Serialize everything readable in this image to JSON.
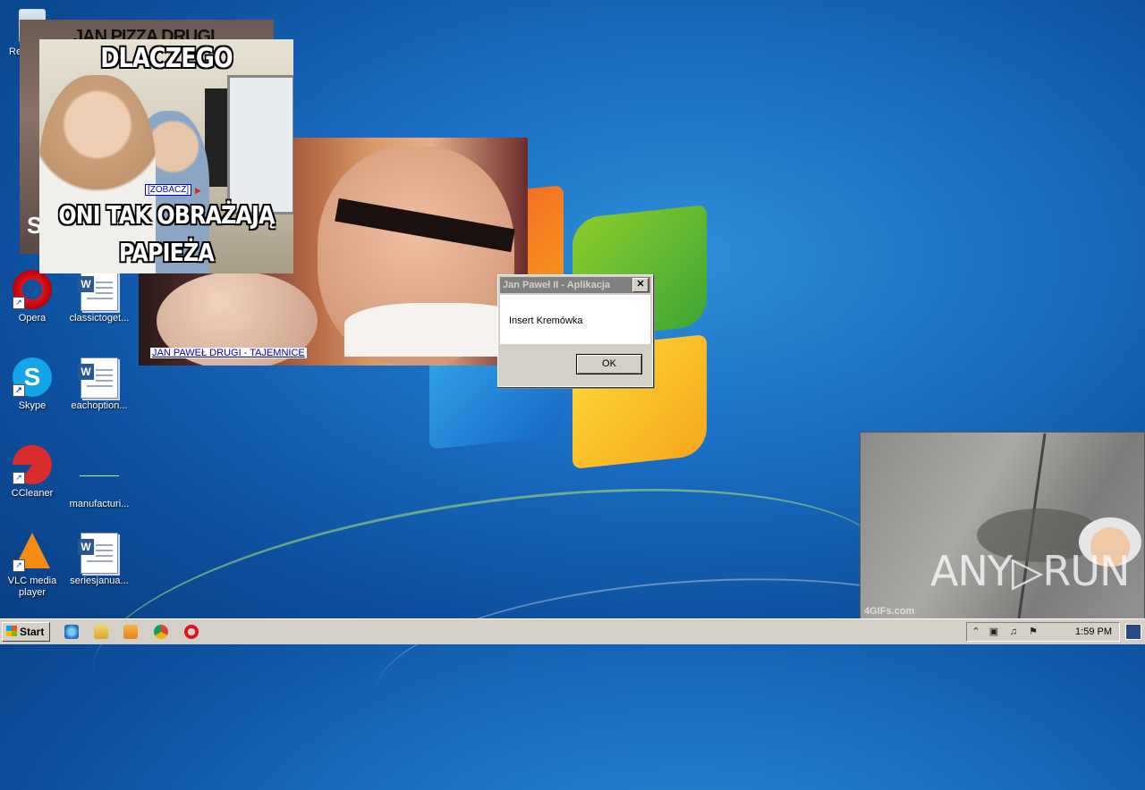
{
  "desktop": {
    "icons": [
      {
        "label": "Opera"
      },
      {
        "label": "classictoget..."
      },
      {
        "label": "Skype"
      },
      {
        "label": "eachoption..."
      },
      {
        "label": "CCleaner"
      },
      {
        "label": "manufacturi..."
      },
      {
        "label": "VLC media player"
      },
      {
        "label": "seriesjanua..."
      }
    ],
    "partial_label": "Re"
  },
  "popups": {
    "video": {
      "caption": "JAN PAWEŁ DRUGI - TAJEMNICE"
    },
    "meme_back": {
      "top_text": "JAN PIZZA DRUGI",
      "side_text": "S"
    },
    "meme": {
      "top_text": "DLACZEGO",
      "bottom_line1": "ONI TAK OBRAŻAJĄ",
      "bottom_line2": "PAPIEŻA",
      "link": "[ZOBACZ]"
    },
    "gif": {
      "watermark_small": "4GIFs.com"
    }
  },
  "messagebox": {
    "title": "Jan Paweł II - Aplikacja",
    "message": "Insert Kremówka",
    "ok_label": "OK",
    "close_label": "✕"
  },
  "watermark": "ANY▷RUN",
  "taskbar": {
    "start_label": "Start",
    "clock": "1:59 PM"
  }
}
